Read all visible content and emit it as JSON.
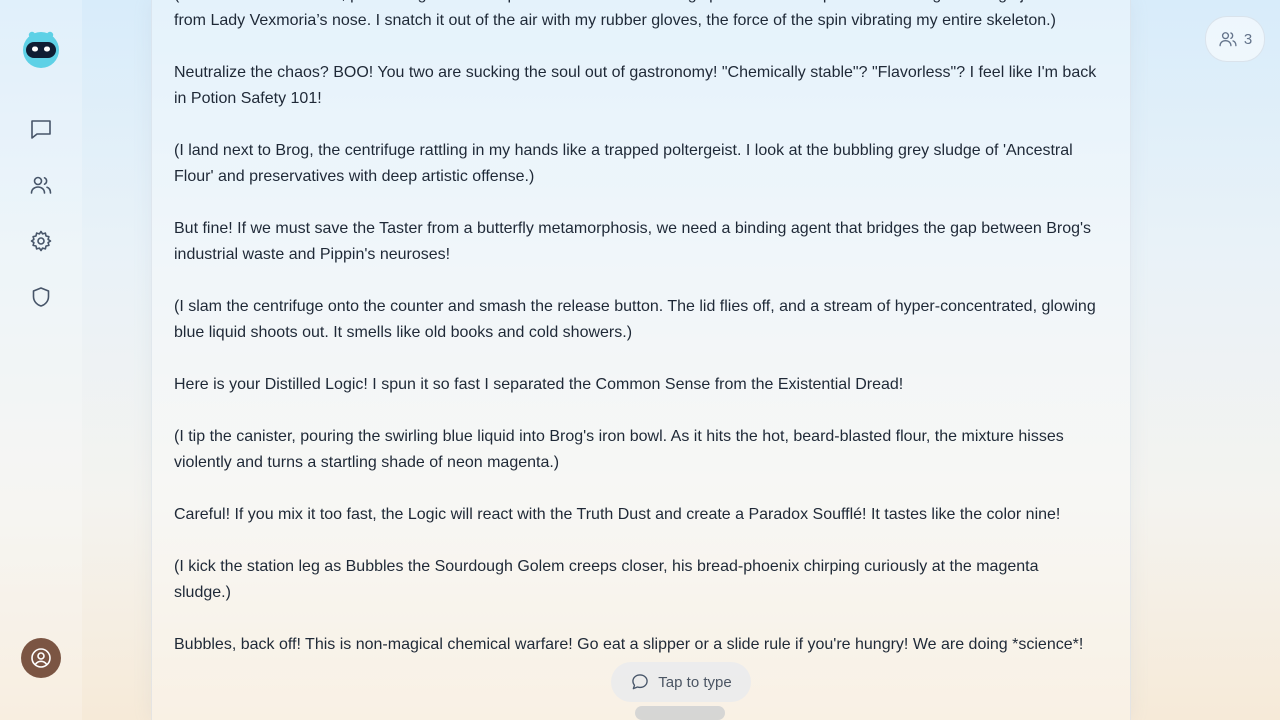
{
  "participants": {
    "count": "3"
  },
  "composer": {
    "placeholder": "Tap to type"
  },
  "message": {
    "paragraphs": [
      "(I vault over the counter, performing a reckless parkour move off a floating spatula to intercept the screaming centrifuge just inches from Lady Vexmoria’s nose. I snatch it out of the air with my rubber gloves, the force of the spin vibrating my entire skeleton.)",
      "Neutralize the chaos? BOO! You two are sucking the soul out of gastronomy! \"Chemically stable\"? \"Flavorless\"? I feel like I'm back in Potion Safety 101!",
      "(I land next to Brog, the centrifuge rattling in my hands like a trapped poltergeist. I look at the bubbling grey sludge of 'Ancestral Flour' and preservatives with deep artistic offense.)",
      "But fine! If we must save the Taster from a butterfly metamorphosis, we need a binding agent that bridges the gap between Brog's industrial waste and Pippin's neuroses!",
      "(I slam the centrifuge onto the counter and smash the release button. The lid flies off, and a stream of hyper-concentrated, glowing blue liquid shoots out. It smells like old books and cold showers.)",
      "Here is your Distilled Logic! I spun it so fast I separated the Common Sense from the Existential Dread!",
      "(I tip the canister, pouring the swirling blue liquid into Brog's iron bowl. As it hits the hot, beard-blasted flour, the mixture hisses violently and turns a startling shade of neon magenta.)",
      "Careful! If you mix it too fast, the Logic will react with the Truth Dust and create a Paradox Soufflé! It tastes like the color nine!",
      "(I kick the station leg as Bubbles the Sourdough Golem creeps closer, his bread-phoenix chirping curiously at the magenta sludge.)",
      "Bubbles, back off! This is non-magical chemical warfare! Go eat a slipper or a slide rule if you're hungry! We are doing *science*!"
    ]
  }
}
